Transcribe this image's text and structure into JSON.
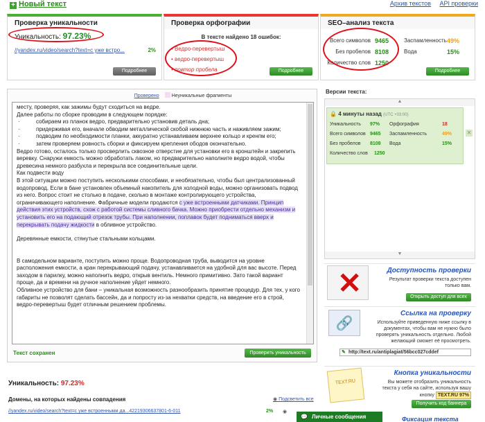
{
  "header": {
    "new_text": "Новый текст",
    "archive": "Архив текстов",
    "api": "API проверки"
  },
  "uniqueness_panel": {
    "title": "Проверка уникальности",
    "label": "Уникальность:",
    "value": "97.23%",
    "url": "//yandex.ru/video/search?text=с уже встро...",
    "url_pct": "2%",
    "more": "Подробнее"
  },
  "spelling_panel": {
    "title": "Проверка орфографии",
    "found": "В тексте найдено 18 ошибок:",
    "errors": [
      "Ведро-перевертыш",
      "ведро-перевертыш",
      "повтор пробела"
    ],
    "more": "Подробнее"
  },
  "seo_panel": {
    "title": "SEO–анализ текста",
    "chars_label": "Всего символов",
    "chars": "9465",
    "nospace_label": "Без пробелов",
    "nospace": "8108",
    "words_label": "Количество слов",
    "words": "1250",
    "spam_label": "Заспамленность",
    "spam": "49%",
    "water_label": "Вода",
    "water": "15%",
    "more": "Подробнее"
  },
  "editor": {
    "checked_link": "Проверено",
    "nonunique": "Неуникальные фрагменты",
    "saved": "Текст сохранен",
    "check_button": "Проверить уникальность",
    "lines": {
      "l1": "месту, проверяя, как зажимы будут сходиться на ведре.",
      "l2": "Далее работы по сборке проводим в следующем порядке:",
      "l3": "собираем из планок ведро, предварительно установив деталь дна;",
      "l4": "придерживая его, вначале обводим металлической скобой нижнюю часть и наживляем зажим;",
      "l5": "подводим по необходимости планки, аккуратно устанавливаем верхнее кольцо и кренпм его;",
      "l6": "затем проверяем ровность сборки и фиксируем крепления ободов окончательно.",
      "l7": "Ведро готово, осталось только просверлить сквозное отверстие для установки его в кронштейн и закрепить веревку. Снаружи емкость можно обработать лаком, но предварительно наполните ведро водой, чтобы древесина немного разбухла и перекрыла все соединительные щели.",
      "l8": "Как подвести воду",
      "l9a": "В этой ситуации можно поступить несколькими способами, и необязательно, чтобы был централизованный водопровод. Если в бане установлен объемный накопитель для холодной воды, можно организовать подвод из него. Вопрос стоит не столько в подаче, сколько в монтаже контролирующего устройства, ограничивающего наполнение. Фабричные модели продаются ",
      "l9b": "с уже встроенными датчиками. Принцип действия этих устройств, схож с работой системы сливного бачка. Можно приобрести отдельно механизм и установить его на подающий отрезок трубы. При наполнении, поплавок будет подниматься вверх и перекрывать подачу жидкости",
      "l9c": " в обливное устройство.",
      "l10": "Деревянные емкости, стянутые стальными кольцами.",
      "l11": "В самодельном варианте, поступить можно проще. Водопроводная труба, выводится на уровне расположения емкости, а кран перекрывающий подачу, устанавливается на удобной для вас высоте. Перед заходом в парилку, можно наполнить ведро, открыв вентиль. Немного примитивно. Зато такой вариант проще, да и времени на ручное наполнение уйдет немного.",
      "l12": "Обливное устройство для бани – уникальная возможность разнообразить принятие процедур. Для тех, у кого габариты не позволят сделать бассейн, да и попросту из-за нехватки средств, на введение его в строй, ведро-перевертыш будет отличным решением проблемы."
    }
  },
  "result": {
    "label": "Уникальность:",
    "value": "97.23%",
    "domains_title": "Домены, на которых найдены совпадения",
    "show_all": "Подсветить все",
    "row_url": "//yandex.ru/video/search?text=с уже встроенными да...42219306637801-6-011",
    "row_pct": "2%"
  },
  "versions": {
    "title": "Версии текста:",
    "time": "4 минуты назад",
    "tz": "(UTC +03:00)",
    "rows": {
      "uniq_label": "Уникальность",
      "uniq": "97%",
      "spell_label": "Орфография",
      "spell": "18",
      "chars_label": "Всего символов",
      "chars": "9465",
      "spam_label": "Заспамленность",
      "spam": "49%",
      "nospace_label": "Без пробелов",
      "nospace": "8108",
      "water_label": "Вода",
      "water": "15%",
      "words_label": "Количество слов",
      "words": "1250"
    }
  },
  "promos": {
    "p1_title": "Доступность проверки",
    "p1_text": "Результат проверки текста доступен только вам.",
    "p1_btn": "Открыть доступ для всех",
    "p2_title": "Ссылка на проверку",
    "p2_text": "Используйте приведенную ниже ссылку в документах, чтобы вам не нужно было проверять уникальность отдельно. Любой желающий сможет её просмотреть.",
    "p2_url": "http://text.ru/antiplagiat/56bcc027cddef",
    "p3_title": "Кнопка уникальности",
    "p3_text": "Вы можете отобразить уникальность текста у себя на сайте, используя вашу кнопку",
    "p3_badge": "TEXT.RU",
    "p3_badge_pct": "97%",
    "p3_btn": "Получить код баннера"
  },
  "chat": "Личные сообщения",
  "bottom_right": "Фиксация текста"
}
